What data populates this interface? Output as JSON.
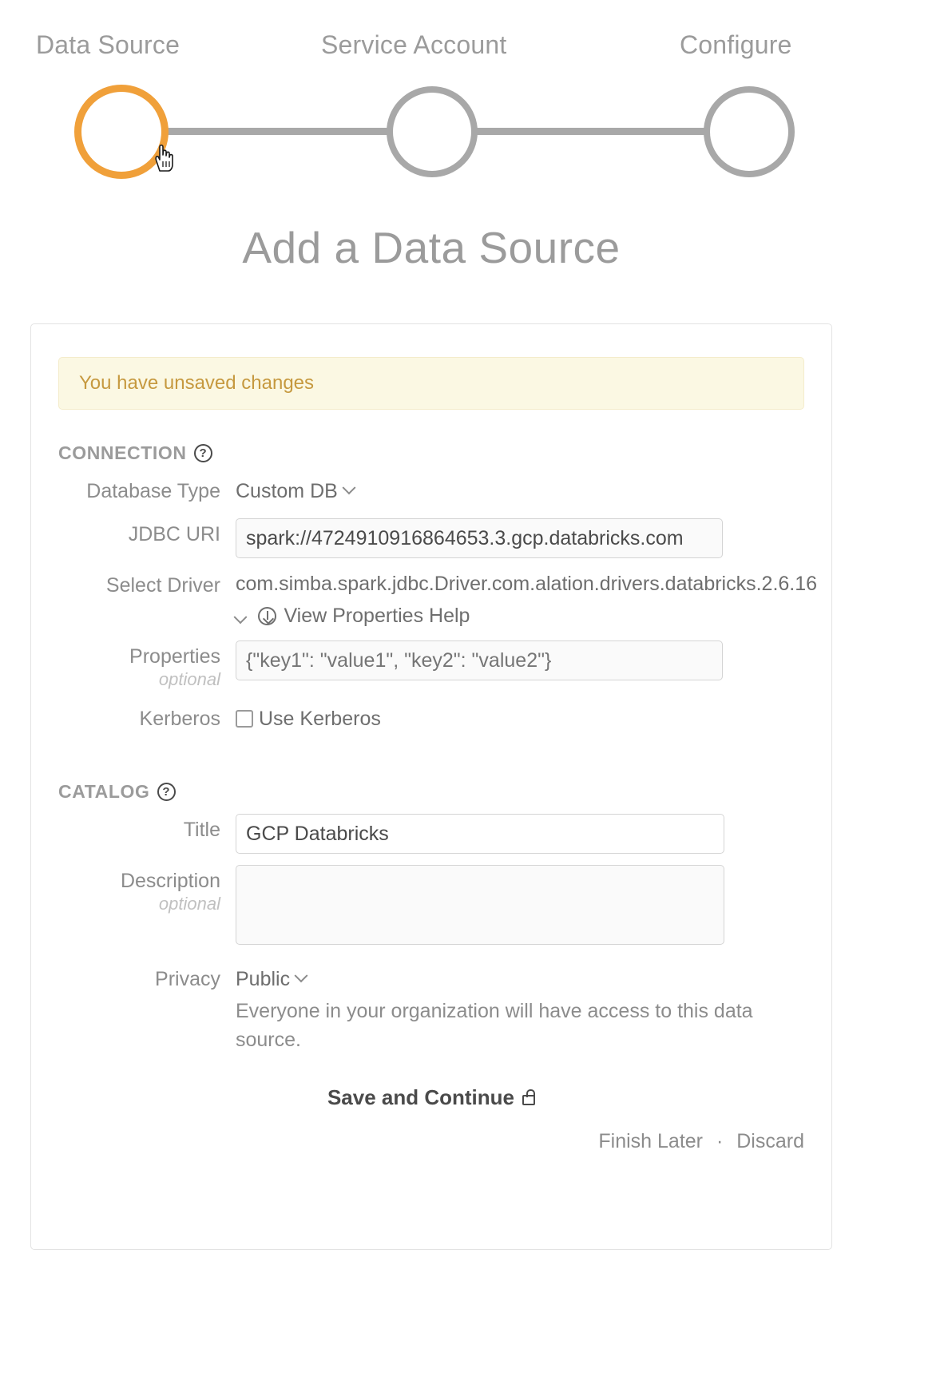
{
  "stepper": {
    "steps": [
      {
        "label": "Data Source",
        "state": "active"
      },
      {
        "label": "Service Account",
        "state": "idle"
      },
      {
        "label": "Configure",
        "state": "idle"
      }
    ],
    "active_color": "#f0a03a",
    "idle_color": "#a8a8a8",
    "cursor": "pointing-hand-cursor"
  },
  "page": {
    "title": "Add a Data Source"
  },
  "banner": {
    "text": "You have unsaved changes",
    "bg": "#fbf8e3",
    "fg": "#c6993f"
  },
  "connection": {
    "heading": "CONNECTION",
    "help_glyph": "?",
    "database_type": {
      "label": "Database Type",
      "value": "Custom DB"
    },
    "jdbc_uri": {
      "label": "JDBC URI",
      "value": "spark://4724910916864653.3.gcp.databricks.com"
    },
    "select_driver": {
      "label": "Select Driver",
      "value": "com.simba.spark.jdbc.Driver.com.alation.drivers.databricks.2.6.16"
    },
    "properties_help": {
      "label": "View Properties Help"
    },
    "properties": {
      "label": "Properties",
      "optional": "optional",
      "placeholder": "{\"key1\": \"value1\", \"key2\": \"value2\"}",
      "value": ""
    },
    "kerberos": {
      "label": "Kerberos",
      "checkbox_label": "Use Kerberos",
      "checked": false
    }
  },
  "catalog": {
    "heading": "CATALOG",
    "help_glyph": "?",
    "title_field": {
      "label": "Title",
      "value": "GCP Databricks"
    },
    "description_field": {
      "label": "Description",
      "optional": "optional",
      "value": ""
    },
    "privacy": {
      "label": "Privacy",
      "value": "Public",
      "description": "Everyone in your organization will have access to this data source."
    }
  },
  "actions": {
    "save_label": "Save and Continue",
    "save_icon": "lock-icon",
    "finish_later": "Finish Later",
    "separator": "·",
    "discard": "Discard"
  }
}
